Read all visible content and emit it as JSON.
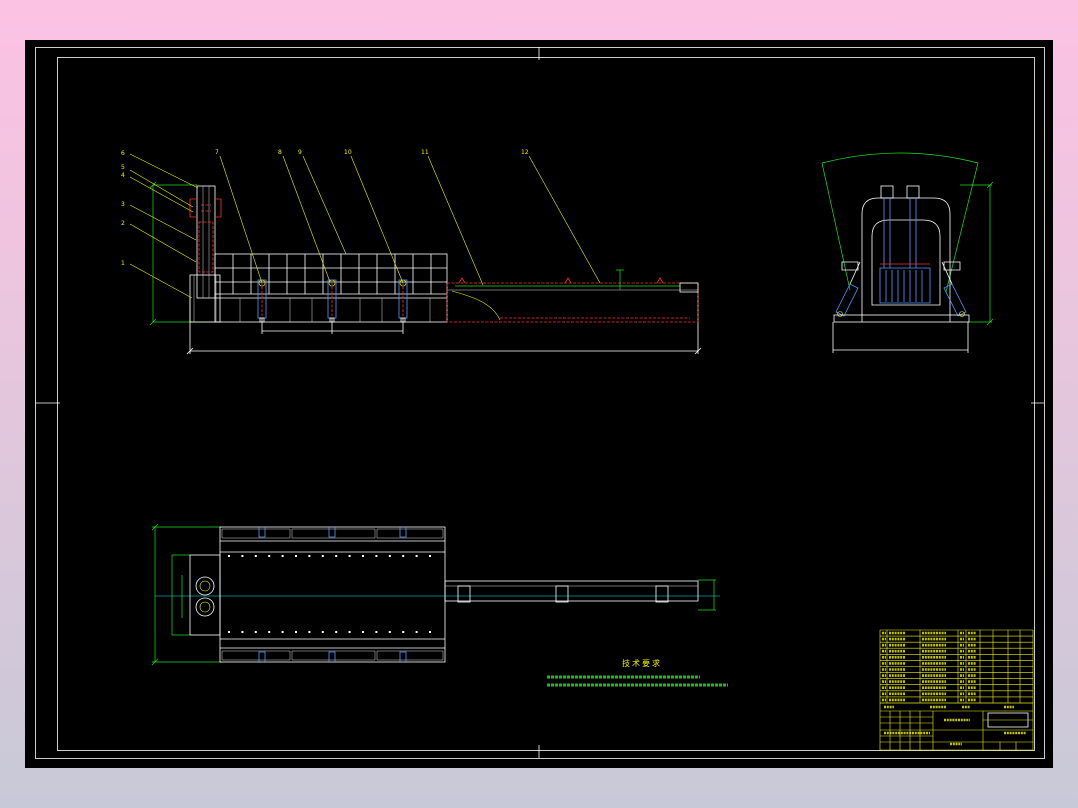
{
  "callouts": [
    {
      "label": "1"
    },
    {
      "label": "2"
    },
    {
      "label": "3"
    },
    {
      "label": "4"
    },
    {
      "label": "5"
    },
    {
      "label": "6"
    },
    {
      "label": "7"
    },
    {
      "label": "8"
    },
    {
      "label": "9"
    },
    {
      "label": "10"
    },
    {
      "label": "11"
    },
    {
      "label": "12"
    }
  ],
  "technical_requirements": {
    "heading": "技术要求"
  },
  "colors": {
    "drawing_background": "#000000",
    "frame": "#ffffff",
    "leader_and_text": "#f2f200",
    "dimension": "#22e022",
    "hidden_part": "#ff3030",
    "cylinder": "#4f9cff",
    "center_line": "#00f0f0"
  }
}
